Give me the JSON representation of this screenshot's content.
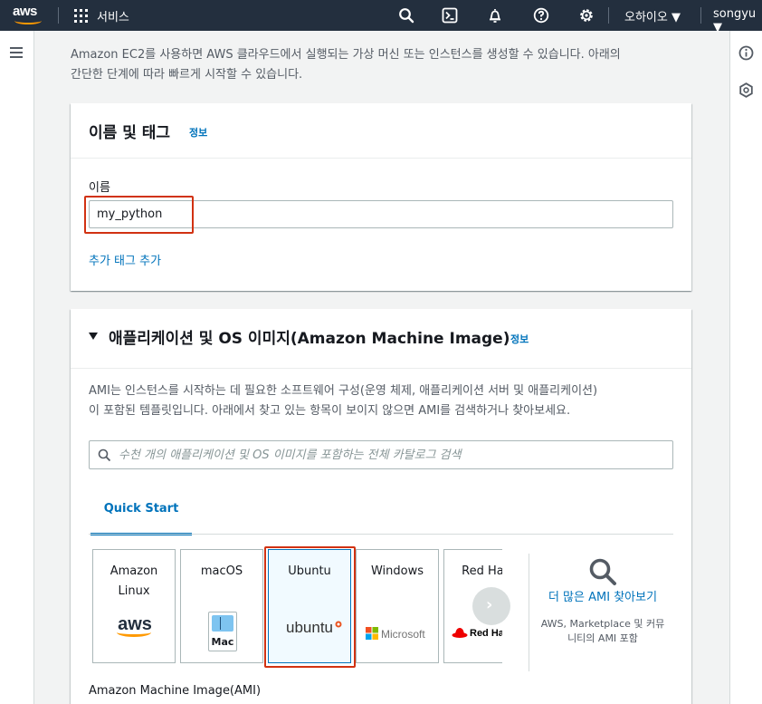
{
  "nav": {
    "services": "서비스",
    "region": "오하이오 ▼",
    "user": "songyu ▼",
    "logo_text": "aws"
  },
  "intro": {
    "line1": "Amazon EC2를 사용하면 AWS 클라우드에서 실행되는 가상 머신 또는 인스턴스를 생성할 수 있습니다. 아래의",
    "line2": "간단한 단계에 따라 빠르게 시작할 수 있습니다."
  },
  "name_tags": {
    "title": "이름 및 태그",
    "info": "정보",
    "name_label": "이름",
    "name_value": "my_python",
    "add_tag": "추가 태그 추가"
  },
  "ami": {
    "title": "애플리케이션 및 OS 이미지(Amazon Machine Image)",
    "info": "정보",
    "desc1": "AMI는 인스턴스를 시작하는 데 필요한 소프트웨어 구성(운영 체제, 애플리케이션 서버 및 애플리케이션)",
    "desc2": "이 포함된 템플릿입니다. 아래에서 찾고 있는 항목이 보이지 않으면 AMI를 검색하거나 찾아보세요.",
    "search_placeholder": "수천 개의 애플리케이션 및 OS 이미지를 포함하는 전체 카탈로그 검색",
    "tab": "Quick Start",
    "tiles": [
      {
        "name": "Amazon\nLinux",
        "logo": "aws"
      },
      {
        "name": "macOS",
        "logo": "Mac"
      },
      {
        "name": "Ubuntu",
        "logo": "ubuntu"
      },
      {
        "name": "Windows",
        "logo": "Microsoft"
      },
      {
        "name": "Red Hat",
        "logo": "Red Hat"
      }
    ],
    "more_link": "더 많은 AMI 찾아보기",
    "more_sub": "AWS, Marketplace 및 커뮤니티의 AMI 포함",
    "ami_label": "Amazon Machine Image(AMI)"
  },
  "colors": {
    "nav_bg": "#232f3e",
    "link": "#0073bb",
    "highlight": "#d13212",
    "aws_orange": "#ff9900"
  }
}
